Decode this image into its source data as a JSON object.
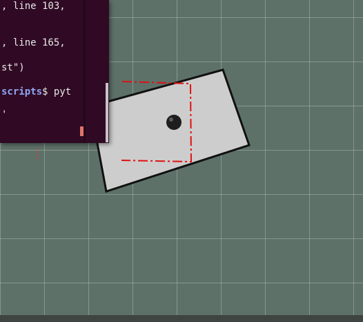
{
  "terminal": {
    "lines": [
      ", line 103,",
      ", line 165,",
      "st\")",
      "",
      "'"
    ],
    "prompt_path": "scripts",
    "prompt_symbol": "$",
    "prompt_command": "pyt"
  },
  "colors": {
    "terminal_bg": "#300a24",
    "grid_bg": "#5d7169",
    "map_free": "#cdcdcd",
    "map_wall": "#111111",
    "robot_path": "#e01010"
  },
  "icons": {
    "robot": "robot-icon"
  }
}
